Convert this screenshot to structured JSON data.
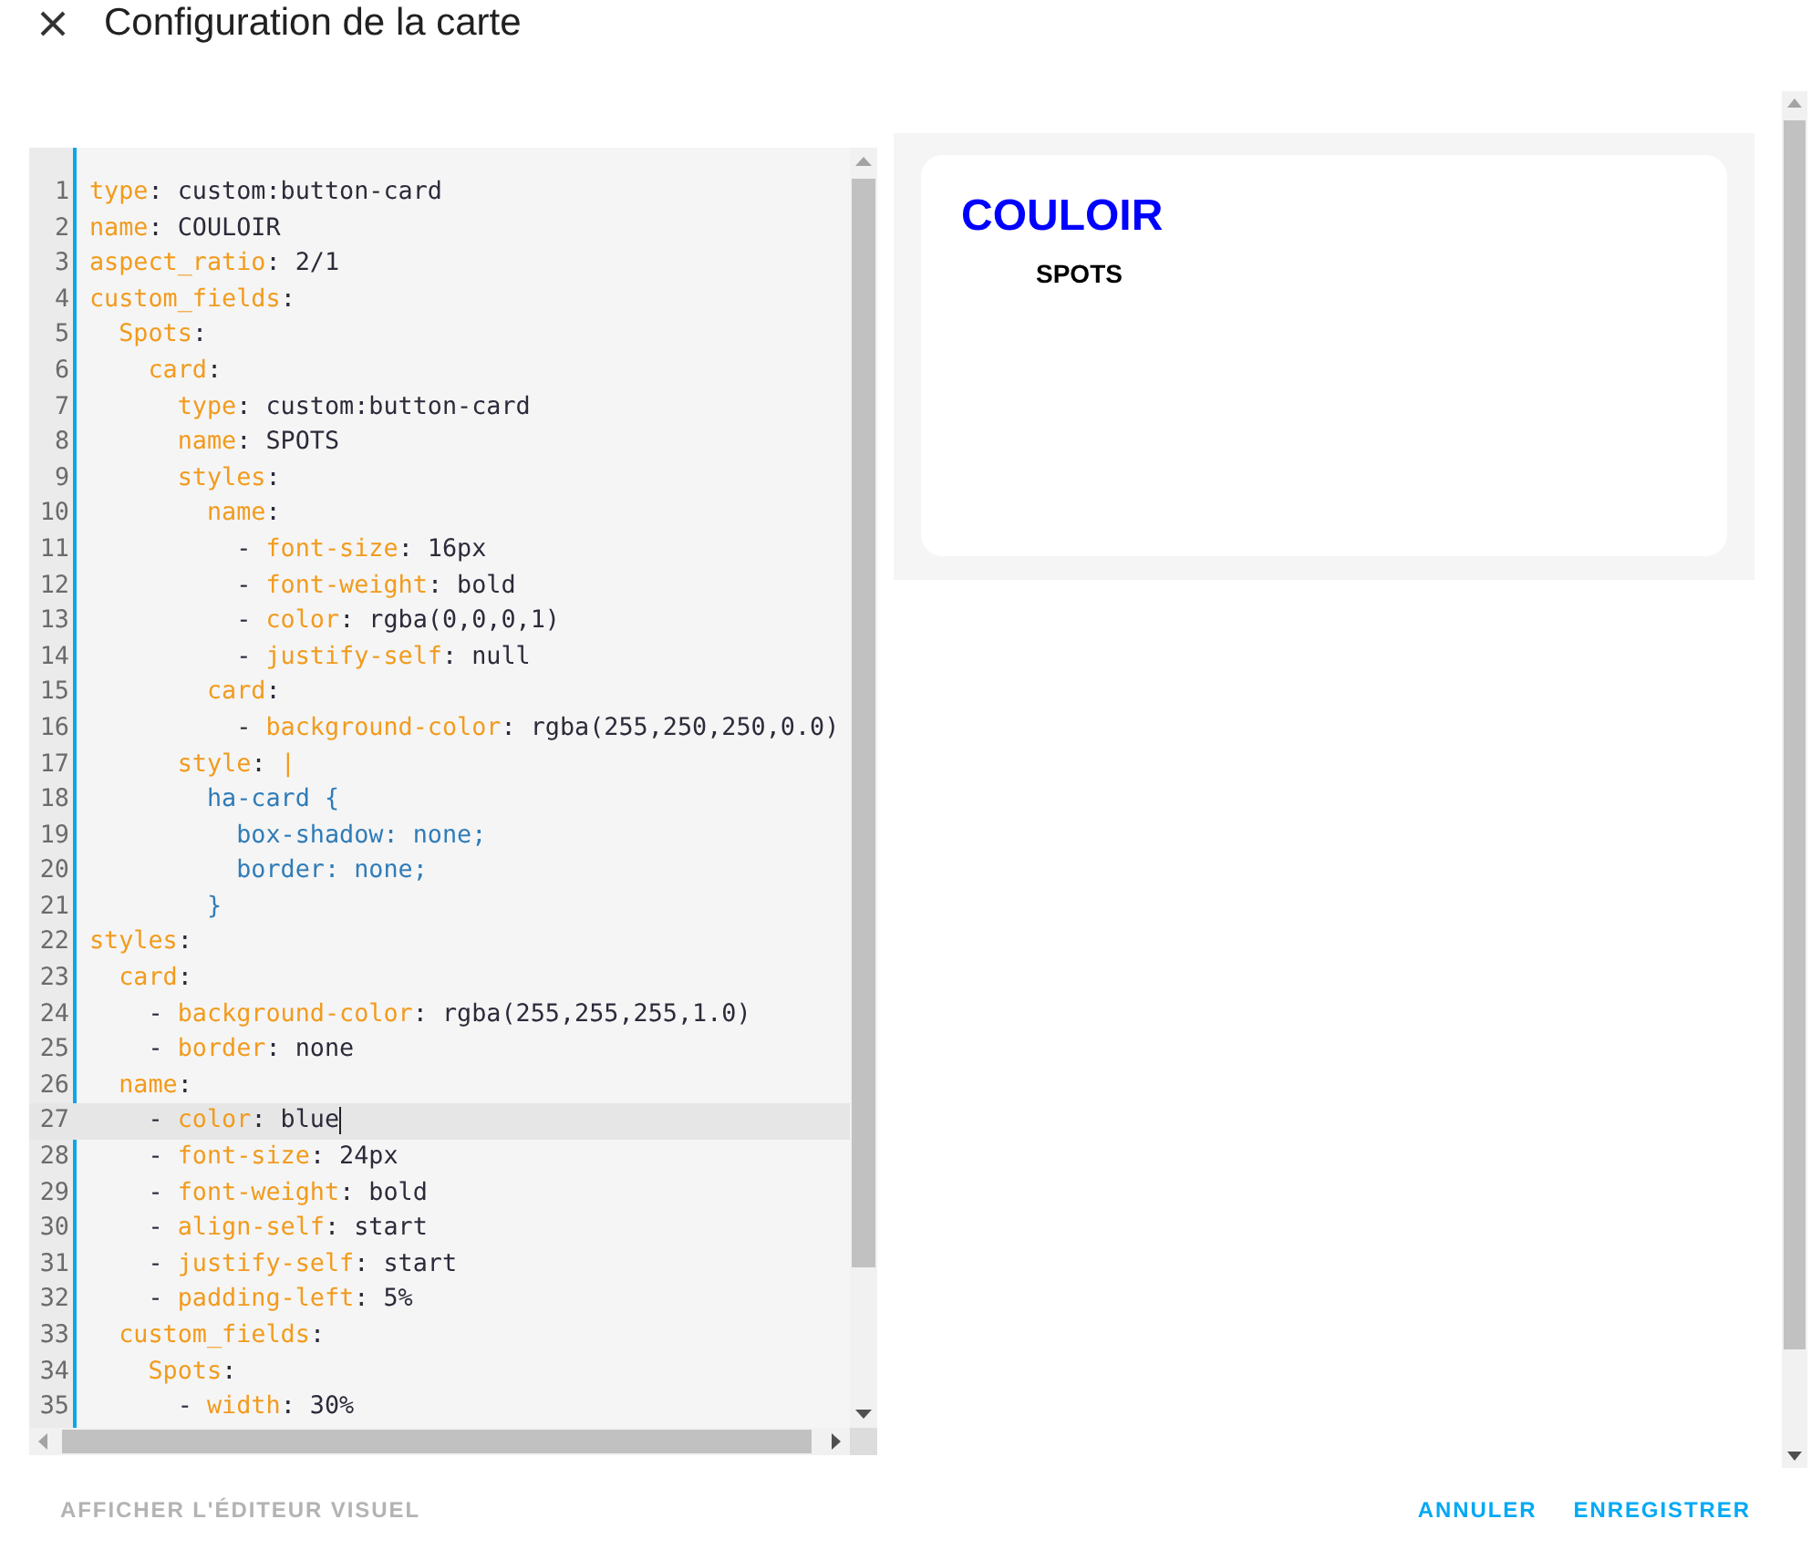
{
  "dialog": {
    "title": "Configuration de la carte"
  },
  "editor": {
    "lines": [
      {
        "number": "1",
        "tokens": [
          {
            "kind": "key",
            "text": "type"
          },
          {
            "kind": "plain",
            "text": ": custom:button-card"
          }
        ]
      },
      {
        "number": "2",
        "tokens": [
          {
            "kind": "key",
            "text": "name"
          },
          {
            "kind": "plain",
            "text": ": COULOIR"
          }
        ]
      },
      {
        "number": "3",
        "tokens": [
          {
            "kind": "key",
            "text": "aspect_ratio"
          },
          {
            "kind": "plain",
            "text": ": 2/1"
          }
        ]
      },
      {
        "number": "4",
        "tokens": [
          {
            "kind": "key",
            "text": "custom_fields"
          },
          {
            "kind": "plain",
            "text": ":"
          }
        ]
      },
      {
        "number": "5",
        "tokens": [
          {
            "kind": "key",
            "text": "  Spots"
          },
          {
            "kind": "plain",
            "text": ":"
          }
        ]
      },
      {
        "number": "6",
        "tokens": [
          {
            "kind": "key",
            "text": "    card"
          },
          {
            "kind": "plain",
            "text": ":"
          }
        ]
      },
      {
        "number": "7",
        "tokens": [
          {
            "kind": "key",
            "text": "      type"
          },
          {
            "kind": "plain",
            "text": ": custom:button-card"
          }
        ]
      },
      {
        "number": "8",
        "tokens": [
          {
            "kind": "key",
            "text": "      name"
          },
          {
            "kind": "plain",
            "text": ": SPOTS"
          }
        ]
      },
      {
        "number": "9",
        "tokens": [
          {
            "kind": "key",
            "text": "      styles"
          },
          {
            "kind": "plain",
            "text": ":"
          }
        ]
      },
      {
        "number": "10",
        "tokens": [
          {
            "kind": "key",
            "text": "        name"
          },
          {
            "kind": "plain",
            "text": ":"
          }
        ]
      },
      {
        "number": "11",
        "tokens": [
          {
            "kind": "plain",
            "text": "          - "
          },
          {
            "kind": "key",
            "text": "font-size"
          },
          {
            "kind": "plain",
            "text": ": 16px"
          }
        ]
      },
      {
        "number": "12",
        "tokens": [
          {
            "kind": "plain",
            "text": "          - "
          },
          {
            "kind": "key",
            "text": "font-weight"
          },
          {
            "kind": "plain",
            "text": ": bold"
          }
        ]
      },
      {
        "number": "13",
        "tokens": [
          {
            "kind": "plain",
            "text": "          - "
          },
          {
            "kind": "key",
            "text": "color"
          },
          {
            "kind": "plain",
            "text": ": rgba(0,0,0,1)"
          }
        ]
      },
      {
        "number": "14",
        "tokens": [
          {
            "kind": "plain",
            "text": "          - "
          },
          {
            "kind": "key",
            "text": "justify-self"
          },
          {
            "kind": "plain",
            "text": ": null"
          }
        ]
      },
      {
        "number": "15",
        "tokens": [
          {
            "kind": "key",
            "text": "        card"
          },
          {
            "kind": "plain",
            "text": ":"
          }
        ]
      },
      {
        "number": "16",
        "tokens": [
          {
            "kind": "plain",
            "text": "          - "
          },
          {
            "kind": "key",
            "text": "background-color"
          },
          {
            "kind": "plain",
            "text": ": rgba(255,250,250,0.0)"
          }
        ]
      },
      {
        "number": "17",
        "tokens": [
          {
            "kind": "key",
            "text": "      style"
          },
          {
            "kind": "plain",
            "text": ": "
          },
          {
            "kind": "key",
            "text": "|"
          }
        ]
      },
      {
        "number": "18",
        "tokens": [
          {
            "kind": "css",
            "text": "        ha-card {"
          }
        ]
      },
      {
        "number": "19",
        "tokens": [
          {
            "kind": "css",
            "text": "          box-shadow: none;"
          }
        ]
      },
      {
        "number": "20",
        "tokens": [
          {
            "kind": "css",
            "text": "          border: none;"
          }
        ]
      },
      {
        "number": "21",
        "tokens": [
          {
            "kind": "css",
            "text": "        }"
          }
        ]
      },
      {
        "number": "22",
        "tokens": [
          {
            "kind": "key",
            "text": "styles"
          },
          {
            "kind": "plain",
            "text": ":"
          }
        ]
      },
      {
        "number": "23",
        "tokens": [
          {
            "kind": "key",
            "text": "  card"
          },
          {
            "kind": "plain",
            "text": ":"
          }
        ]
      },
      {
        "number": "24",
        "tokens": [
          {
            "kind": "plain",
            "text": "    - "
          },
          {
            "kind": "key",
            "text": "background-color"
          },
          {
            "kind": "plain",
            "text": ": rgba(255,255,255,1.0)"
          }
        ]
      },
      {
        "number": "25",
        "tokens": [
          {
            "kind": "plain",
            "text": "    - "
          },
          {
            "kind": "key",
            "text": "border"
          },
          {
            "kind": "plain",
            "text": ": none"
          }
        ]
      },
      {
        "number": "26",
        "tokens": [
          {
            "kind": "key",
            "text": "  name"
          },
          {
            "kind": "plain",
            "text": ":"
          }
        ]
      },
      {
        "number": "27",
        "active": true,
        "tokens": [
          {
            "kind": "plain",
            "text": "    - "
          },
          {
            "kind": "key",
            "text": "color"
          },
          {
            "kind": "plain",
            "text": ": blue"
          }
        ]
      },
      {
        "number": "28",
        "tokens": [
          {
            "kind": "plain",
            "text": "    - "
          },
          {
            "kind": "key",
            "text": "font-size"
          },
          {
            "kind": "plain",
            "text": ": 24px"
          }
        ]
      },
      {
        "number": "29",
        "tokens": [
          {
            "kind": "plain",
            "text": "    - "
          },
          {
            "kind": "key",
            "text": "font-weight"
          },
          {
            "kind": "plain",
            "text": ": bold"
          }
        ]
      },
      {
        "number": "30",
        "tokens": [
          {
            "kind": "plain",
            "text": "    - "
          },
          {
            "kind": "key",
            "text": "align-self"
          },
          {
            "kind": "plain",
            "text": ": start"
          }
        ]
      },
      {
        "number": "31",
        "tokens": [
          {
            "kind": "plain",
            "text": "    - "
          },
          {
            "kind": "key",
            "text": "justify-self"
          },
          {
            "kind": "plain",
            "text": ": start"
          }
        ]
      },
      {
        "number": "32",
        "tokens": [
          {
            "kind": "plain",
            "text": "    - "
          },
          {
            "kind": "key",
            "text": "padding-left"
          },
          {
            "kind": "plain",
            "text": ": 5%"
          }
        ]
      },
      {
        "number": "33",
        "tokens": [
          {
            "kind": "key",
            "text": "  custom_fields"
          },
          {
            "kind": "plain",
            "text": ":"
          }
        ]
      },
      {
        "number": "34",
        "tokens": [
          {
            "kind": "key",
            "text": "    Spots"
          },
          {
            "kind": "plain",
            "text": ":"
          }
        ]
      },
      {
        "number": "35",
        "tokens": [
          {
            "kind": "plain",
            "text": "      - "
          },
          {
            "kind": "key",
            "text": "width"
          },
          {
            "kind": "plain",
            "text": ": 30%"
          }
        ]
      }
    ]
  },
  "preview": {
    "name": "COULOIR",
    "field": "SPOTS"
  },
  "footer": {
    "left_button": "AFFICHER L'ÉDITEUR VISUEL",
    "buttons": [
      "ANNULER",
      "ENREGISTRER"
    ]
  }
}
